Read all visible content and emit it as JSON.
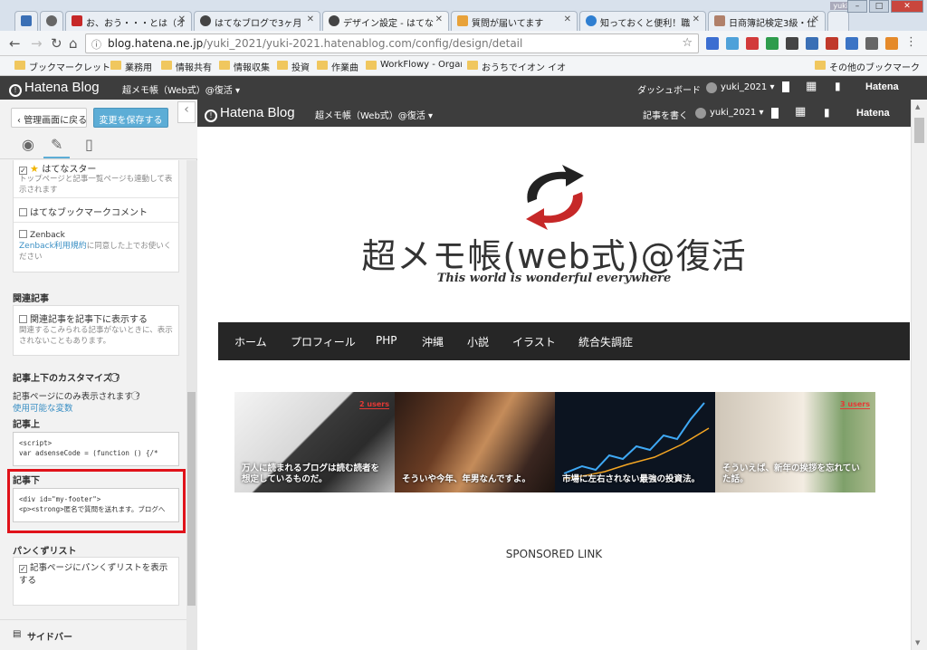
{
  "browser": {
    "tabs": [
      {
        "title": "",
        "icon": "hatena-y-icon"
      },
      {
        "title": "",
        "icon": "circle-icon"
      },
      {
        "title": "お、おう・・・とは（オ",
        "icon": "robot-icon"
      },
      {
        "title": "はてなブログで3ヶ月",
        "icon": "hatena-icon"
      },
      {
        "title": "デザイン設定 - はてな",
        "icon": "hatena-icon"
      },
      {
        "title": "質問が届いてます",
        "icon": "envelope-icon"
      },
      {
        "title": "知っておくと便利！職",
        "icon": "globe-icon"
      },
      {
        "title": "日商簿記検定3級・仕",
        "icon": "person-icon"
      }
    ],
    "window_user": "yuki",
    "url_host": "blog.hatena.ne.jp",
    "url_path": "/yuki_2021/yuki-2021.hatenablog.com/config/design/detail",
    "bookmarks": [
      "ブックマークレット",
      "業務用",
      "情報共有",
      "情報収集",
      "投資",
      "作業曲",
      "WorkFlowy - Organ",
      "おうちでイオン イオ"
    ],
    "other_bookmarks": "その他のブックマーク"
  },
  "hatena": {
    "logo": "Hatena Blog",
    "blog_name": "超メモ帳（Web式）@復活 ▾",
    "dashboard": "ダッシュボード",
    "user": "yuki_2021 ▾",
    "brand": "Hatena"
  },
  "left_panel": {
    "back_button": "管理画面に戻る",
    "save_button": "変更を保存する",
    "star_label": "はてなスター",
    "star_note": "トップページと記事一覧ページも連動して表示されます",
    "bookmark_comment": "はてなブックマークコメント",
    "zenback": "Zenback",
    "zenback_link": "Zenback利用規約",
    "zenback_note": "に同意した上でお使いください",
    "related_title": "関連記事",
    "related_label": "関連記事を記事下に表示する",
    "related_note": "関連するこみられる記事がないときに、表示されないこともあります。",
    "customize_title": "記事上下のカスタマイズ",
    "customize_note": "記事ページにのみ表示されます",
    "variables_link": "使用可能な変数",
    "above_title": "記事上",
    "above_code_1": "<script>",
    "above_code_2": "var adsenseCode = (function () {/*",
    "below_title": "記事下",
    "below_code_1": "<div id=\"my-footer\">",
    "below_code_2": "<p><strong>匿名で質問を送れます。ブログへ",
    "breadcrumb_title": "パンくずリスト",
    "breadcrumb_label": "記事ページにパンくずリストを表示する",
    "sidebar_label": "サイドバー"
  },
  "preview": {
    "logo": "Hatena Blog",
    "blog_name": "超メモ帳（Web式）@復活 ▾",
    "write": "記事を書く",
    "user": "yuki_2021 ▾",
    "brand": "Hatena",
    "title": "超メモ帳(web式)@復活",
    "tagline": "This world is wonderful everywhere",
    "nav": [
      "ホーム",
      "プロフィール",
      "PHP",
      "沖縄",
      "小説",
      "イラスト",
      "統合失調症"
    ],
    "cards": [
      {
        "users": "2 users",
        "text": "万人に読まれるブログは読む読者を想定しているものだ。"
      },
      {
        "users": "",
        "text": "そういや今年、年男なんですよ。"
      },
      {
        "users": "",
        "text": "市場に左右されない最強の投資法。"
      },
      {
        "users": "3 users",
        "text": "そういえば、新年の挨拶を忘れていた話。"
      }
    ],
    "sponsored": "SPONSORED LINK"
  },
  "colors": {
    "accent": "#5dadd6",
    "highlight": "#e0121a",
    "nav_bg": "#262626",
    "bar_bg": "#3d3d3d"
  }
}
